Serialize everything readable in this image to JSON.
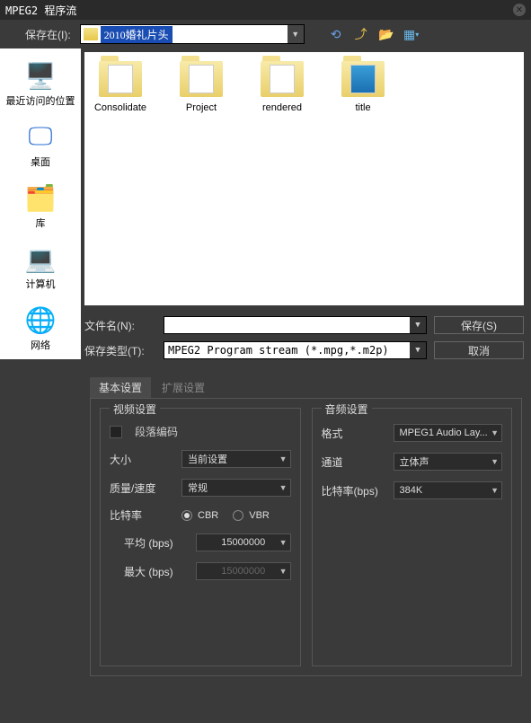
{
  "title": "MPEG2 程序流",
  "saveInLabel": "保存在(I):",
  "pathText": "2010婚礼片头",
  "sidebar": {
    "items": [
      {
        "label": "最近访问的位置"
      },
      {
        "label": "桌面"
      },
      {
        "label": "库"
      },
      {
        "label": "计算机"
      },
      {
        "label": "网络"
      }
    ]
  },
  "folders": [
    {
      "name": "Consolidate"
    },
    {
      "name": "Project"
    },
    {
      "name": "rendered"
    },
    {
      "name": "title"
    }
  ],
  "filenameLabel": "文件名(N):",
  "filenameValue": "",
  "filetypeLabel": "保存类型(T):",
  "filetypeValue": "MPEG2 Program stream (*.mpg,*.m2p)",
  "saveBtn": "保存(S)",
  "cancelBtn": "取消",
  "tabs": {
    "basic": "基本设置",
    "advanced": "扩展设置"
  },
  "video": {
    "title": "视频设置",
    "paragraphEncoding": "段落编码",
    "sizeLabel": "大小",
    "sizeValue": "当前设置",
    "qualityLabel": "质量/速度",
    "qualityValue": "常规",
    "bitrateLabel": "比特率",
    "cbr": "CBR",
    "vbr": "VBR",
    "avgLabel": "平均 (bps)",
    "avgValue": "15000000",
    "maxLabel": "最大 (bps)",
    "maxValue": "15000000"
  },
  "audio": {
    "title": "音频设置",
    "formatLabel": "格式",
    "formatValue": "MPEG1 Audio Lay...",
    "channelLabel": "通道",
    "channelValue": "立体声",
    "bitrateLabel": "比特率(bps)",
    "bitrateValue": "384K"
  }
}
